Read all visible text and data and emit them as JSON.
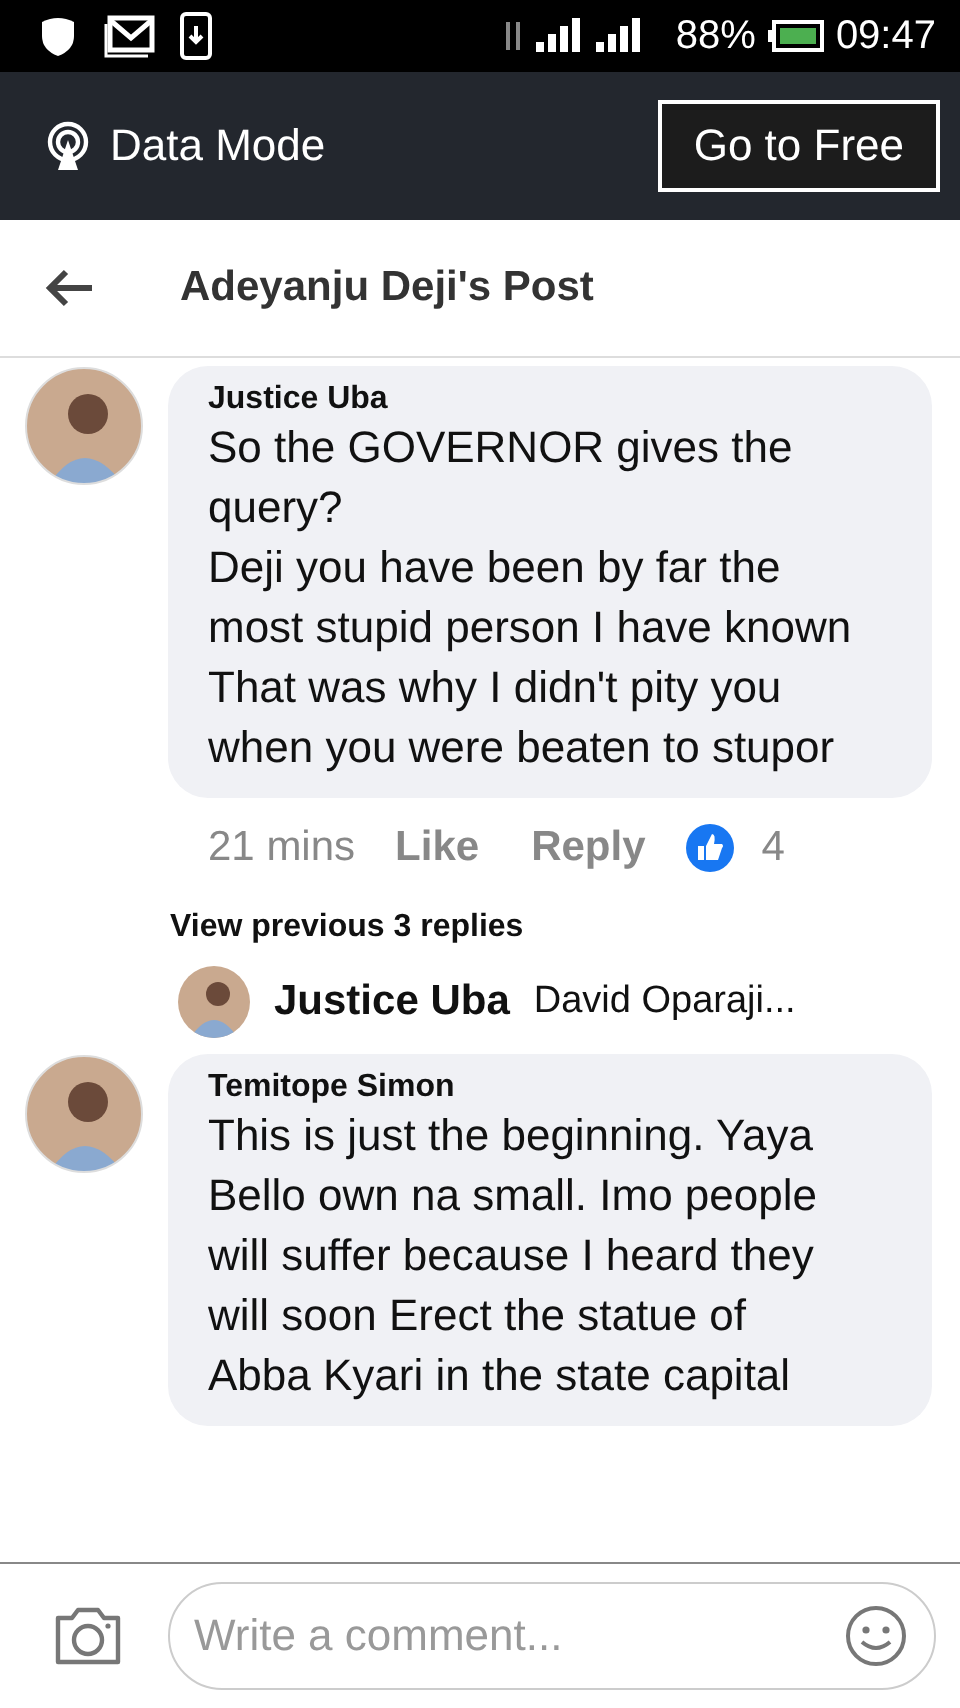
{
  "status_bar": {
    "battery": "88%",
    "time": "09:47"
  },
  "data_banner": {
    "label": "Data Mode",
    "button": "Go to Free"
  },
  "header": {
    "title": "Adeyanju Deji's Post"
  },
  "comments": [
    {
      "author": "Justice Uba",
      "paragraphs": [
        "So the GOVERNOR gives the query?",
        "Deji you have been by far the most stupid person I have known",
        "That was why I didn't pity you when you were beaten to stupor"
      ],
      "time": "21 mins",
      "like": "Like",
      "reply": "Reply",
      "reactions": "4",
      "view_replies": "View previous 3 replies",
      "reply_preview": {
        "author": "Justice Uba",
        "text": "David Oparaji..."
      }
    },
    {
      "author": "Temitope Simon",
      "paragraphs": [
        "This is just the beginning. Yaya Bello own na small. Imo people will suffer because I heard they will soon Erect the statue of Abba Kyari in the state capital"
      ]
    }
  ],
  "composer": {
    "placeholder": "Write a comment..."
  }
}
